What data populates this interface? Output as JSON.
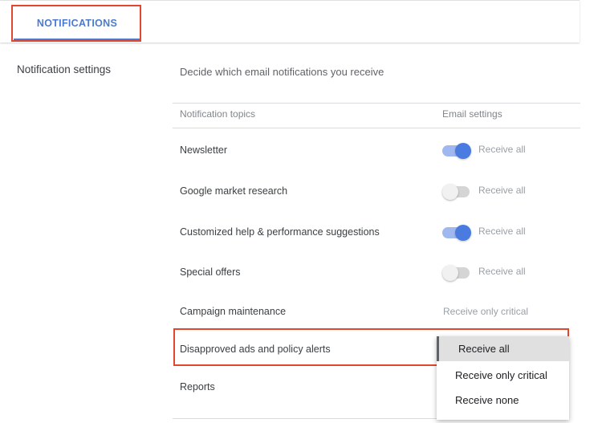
{
  "tab": {
    "label": "NOTIFICATIONS"
  },
  "sidebar": {
    "title": "Notification settings"
  },
  "section": {
    "description": "Decide which email notifications you receive"
  },
  "table": {
    "col_topics": "Notification topics",
    "col_email": "Email settings"
  },
  "rows": [
    {
      "label": "Newsletter",
      "toggle_on": true,
      "setting": "Receive all"
    },
    {
      "label": "Google market research",
      "toggle_on": false,
      "setting": "Receive all"
    },
    {
      "label": "Customized help & performance suggestions",
      "toggle_on": true,
      "setting": "Receive all"
    },
    {
      "label": "Special offers",
      "toggle_on": false,
      "setting": "Receive all"
    },
    {
      "label": "Campaign maintenance",
      "setting": "Receive only critical"
    },
    {
      "label": "Disapproved ads and policy alerts"
    },
    {
      "label": "Reports"
    }
  ],
  "dropdown": {
    "options": [
      "Receive all",
      "Receive only critical",
      "Receive none"
    ],
    "selected": "Receive all"
  },
  "colors": {
    "accent": "#4a7bd0",
    "toggle_on": "#4a7be0",
    "highlight": "#e0472e"
  }
}
